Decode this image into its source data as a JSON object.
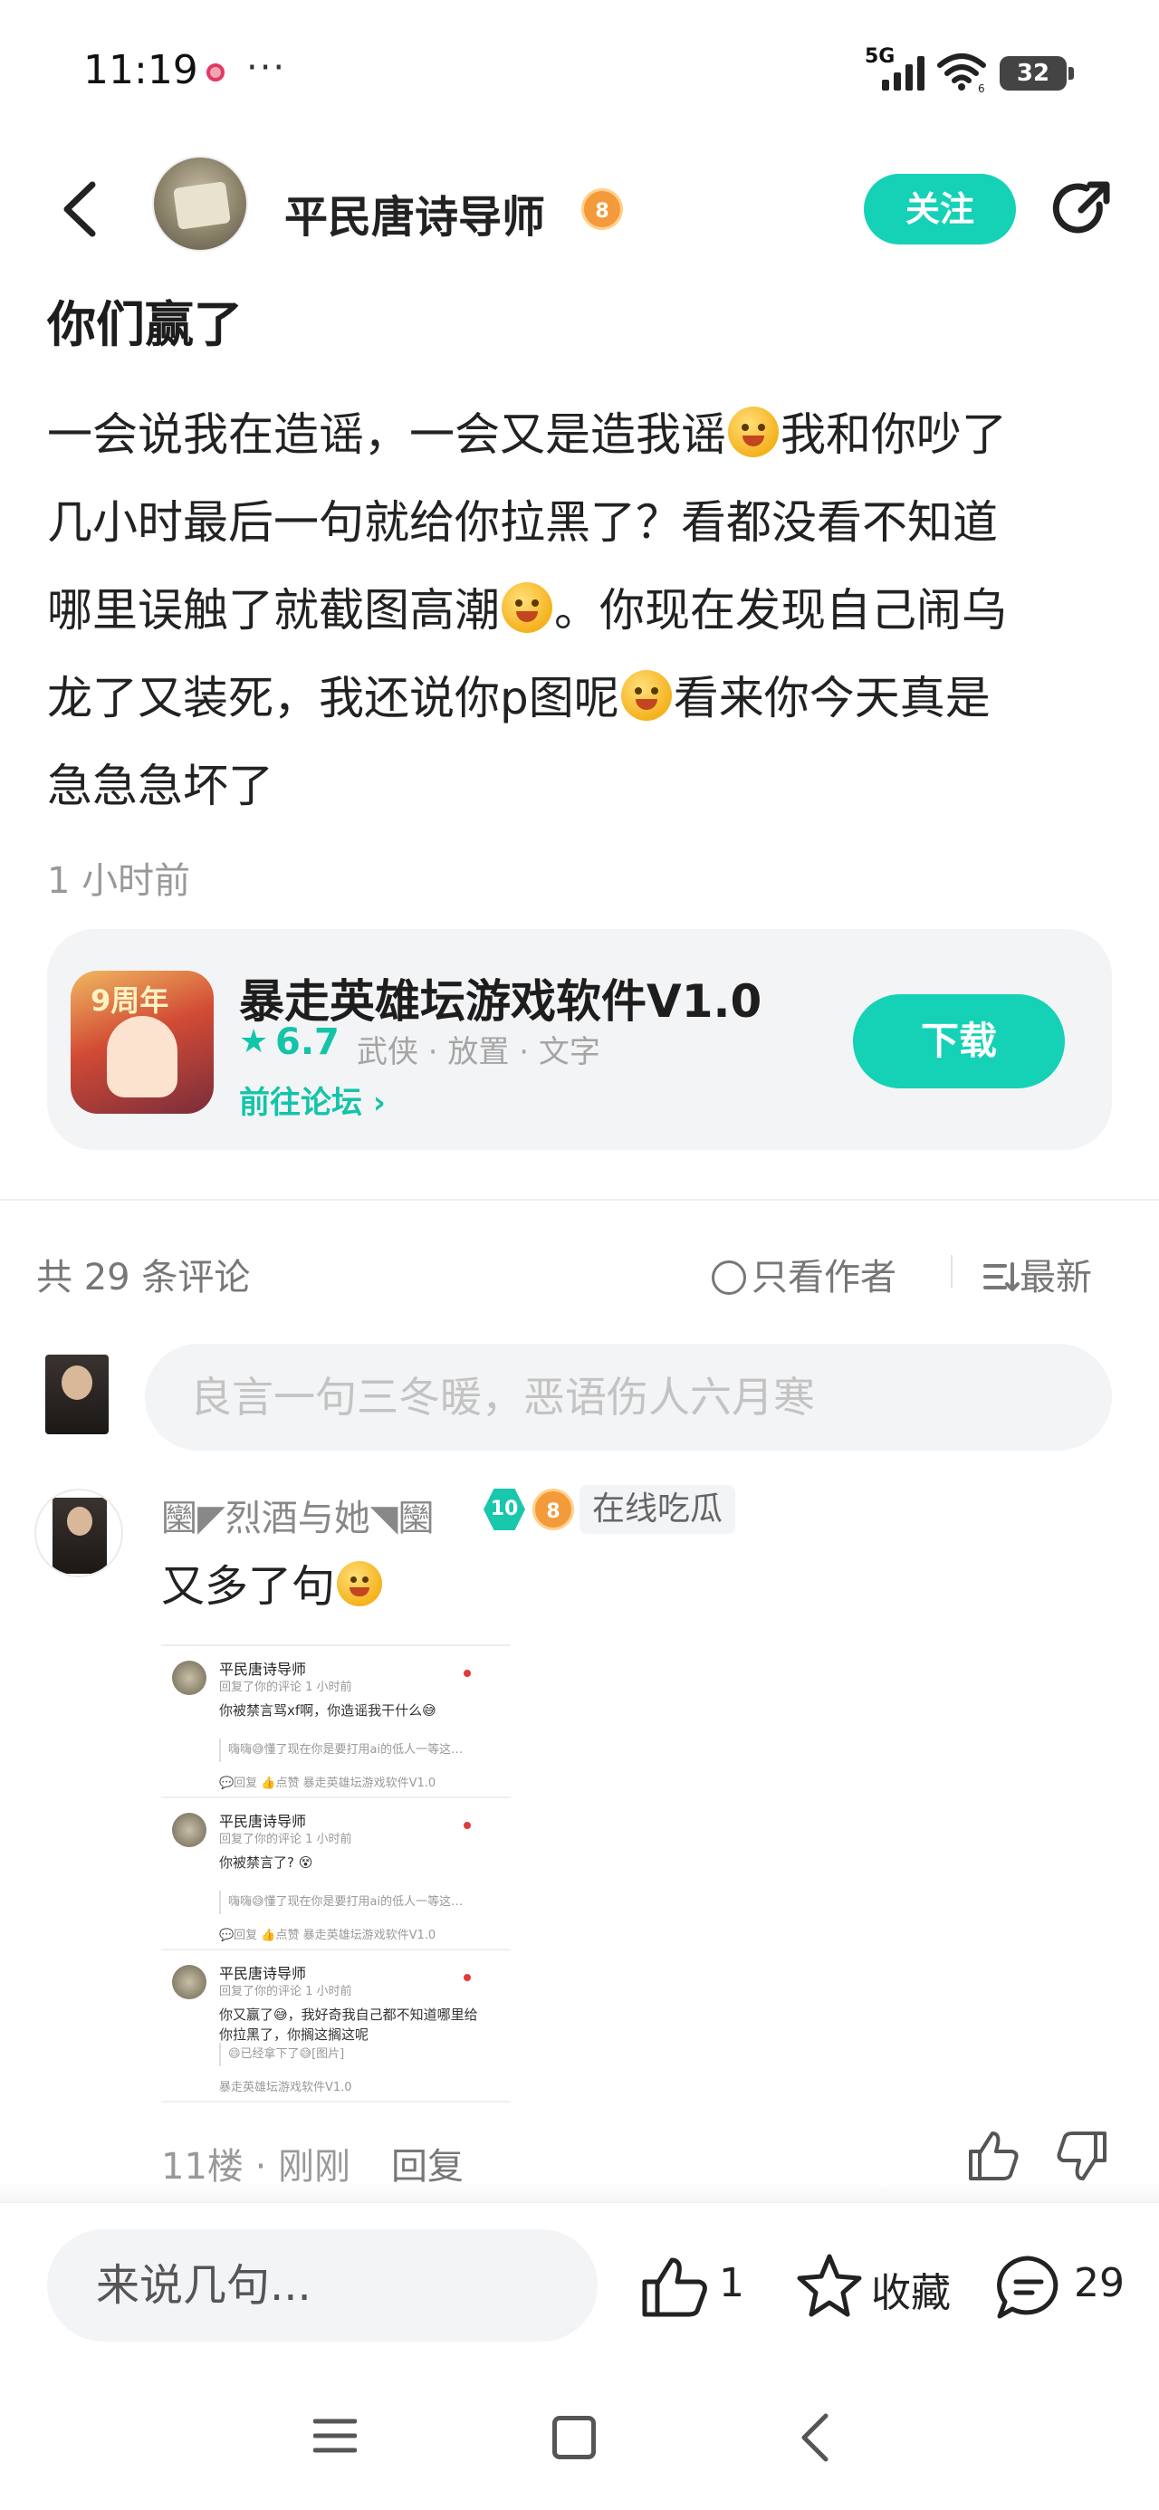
{
  "status": {
    "time": "11:19",
    "more": "···",
    "network": "5G",
    "wifi_sub": "6",
    "battery": "32"
  },
  "header": {
    "author_name": "平民唐诗导师",
    "author_level": "8",
    "follow_label": "关注"
  },
  "post": {
    "title": "你们赢了",
    "body_lines": [
      [
        "一会说我在造谣，一会又是造我谣",
        "我和你吵了"
      ],
      [
        "几小时最后一句就给你拉黑了？看都没看不知道"
      ],
      [
        "哪里误触了就截图高潮",
        "。你现在发现自己闹乌"
      ],
      [
        "龙了又装死，我还说你p图呢",
        "看来你今天真是"
      ],
      [
        "急急急坏了"
      ]
    ],
    "time": "1 小时前"
  },
  "app_card": {
    "icon_text": "9周年",
    "name": "暴走英雄坛游戏软件V1.0",
    "star": "★",
    "rating": "6.7",
    "tags": "武侠 · 放置 · 文字",
    "forum_link": "前往论坛 ›",
    "download_label": "下载"
  },
  "comments_header": {
    "count_label": "共 29 条评论",
    "author_only_label": "只看作者",
    "sort_label": "最新",
    "input_placeholder": "良言一句三冬暖，恶语伤人六月寒"
  },
  "comment": {
    "name": "圞◤烈酒与她◥圞",
    "level_badge": "10",
    "fan_badge": "8",
    "tag": "在线吃瓜",
    "text": "又多了句",
    "floor": "11楼 · 刚刚",
    "reply_label": "回复",
    "screenshot": [
      {
        "name": "平民唐诗导师",
        "sub": "回复了你的评论 1 小时前",
        "text": "你被禁言骂xf啊，你造谣我干什么😅",
        "quote": "嗨嗨😅懂了现在你是要打用ai的低人一等这…",
        "foot": "💬回复   👍点赞          暴走英雄坛游戏软件V1.0"
      },
      {
        "name": "平民唐诗导师",
        "sub": "回复了你的评论 1 小时前",
        "text": "你被禁言了? 😵",
        "quote": "嗨嗨😅懂了现在你是要打用ai的低人一等这…",
        "foot": "💬回复   👍点赞          暴走英雄坛游戏软件V1.0"
      },
      {
        "name": "平民唐诗导师",
        "sub": "回复了你的评论 1 小时前",
        "text": "你又赢了😅，我好奇我自己都不知道哪里给你拉黑了，你搁这搁这呢",
        "quote": "😄已经拿下了😅[图片]",
        "foot": "暴走英雄坛游戏软件V1.0"
      }
    ]
  },
  "bottom_bar": {
    "input_placeholder": "来说几句...",
    "like_count": "1",
    "favorite_label": "收藏",
    "comment_count": "29"
  },
  "colors": {
    "accent": "#15d1b5",
    "accent_text": "#13c4a9"
  }
}
